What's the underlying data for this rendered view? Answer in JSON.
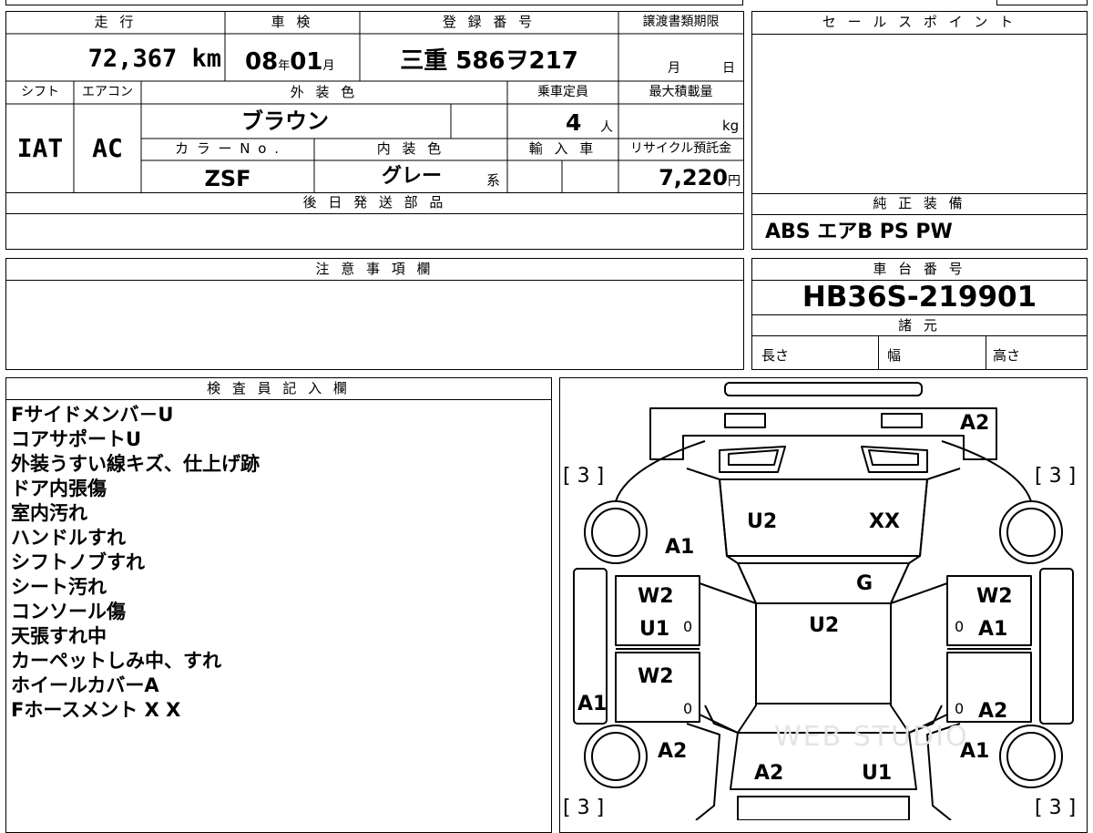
{
  "header": {
    "mileage_label": "走 行",
    "mileage_value": "72,367",
    "mileage_unit": "km",
    "inspection_label": "車 検",
    "inspection_year": "08",
    "inspection_year_unit": "年",
    "inspection_month": "01",
    "inspection_month_unit": "月",
    "registration_label": "登 録 番 号",
    "registration_value": "三重 586ヲ217",
    "transfer_label": "譲渡書類期限",
    "transfer_month_unit": "月",
    "transfer_day_unit": "日"
  },
  "specs": {
    "shift_label": "シフト",
    "shift_value": "IAT",
    "ac_label": "エアコン",
    "ac_value": "AC",
    "exterior_label": "外 装 色",
    "exterior_value": "ブラウン",
    "capacity_label": "乗車定員",
    "capacity_value": "4",
    "capacity_unit": "人",
    "max_load_label": "最大積載量",
    "max_load_unit": "kg",
    "color_no_label": "カ ラ ー N o .",
    "color_no_value": "ZSF",
    "interior_label": "内 装 色",
    "interior_value": "グレー",
    "interior_suffix": "系",
    "import_label": "輸 入 車",
    "recycle_label": "リサイクル預託金",
    "recycle_value": "7,220",
    "recycle_unit": "円"
  },
  "later_parts_label": "後 日 発 送 部 品",
  "sales_point_label": "セ ー ル ス ポ イ ン ト",
  "genuine_equipment_label": "純 正 装 備",
  "genuine_equipment_value": "ABS エアB PS PW",
  "caution_label": "注 意 事 項 欄",
  "chassis_label": "車 台 番 号",
  "chassis_value": "HB36S-219901",
  "dimensions_label": "諸 元",
  "dimensions": {
    "length": "長さ",
    "width": "幅",
    "height": "高さ"
  },
  "inspector_label": "検 査 員 記 入 欄",
  "inspector_notes": [
    "Fサイドメンバ－U",
    "コアサポートU",
    "外装うすい線キズ、仕上げ跡",
    "ドア内張傷",
    "室内汚れ",
    "ハンドルすれ",
    "シフトノブすれ",
    "シート汚れ",
    "コンソール傷",
    "天張すれ中",
    "カーペットしみ中、すれ",
    "ホイールカバーA",
    "Fホースメント X X"
  ],
  "diagram": {
    "tire_bracket_tl": "[ 3 ]",
    "tire_bracket_tr": "[ 3 ]",
    "tire_bracket_bl": "[ 3 ]",
    "tire_bracket_br": "[ 3 ]",
    "bumper_front": "A2",
    "hood_left": "U2",
    "hood_right": "XX",
    "fender_left_front": "A1",
    "windshield": "G",
    "roof": "U2",
    "left_front_door_1": "W2",
    "left_front_door_2": "U1",
    "left_front_door_zero": "0",
    "right_front_door_1": "W2",
    "right_front_door_2": "A1",
    "right_front_door_zero": "0",
    "left_rear_door": "W2",
    "left_rear_door_zero": "0",
    "right_rear_door": "A2",
    "right_rear_door_zero": "0",
    "left_sill": "A1",
    "left_rear_fender": "A2",
    "right_rear_fender": "A1",
    "rear_panel_left": "A2",
    "rear_panel_right": "U1",
    "watermark": "WEB STUDIO"
  }
}
